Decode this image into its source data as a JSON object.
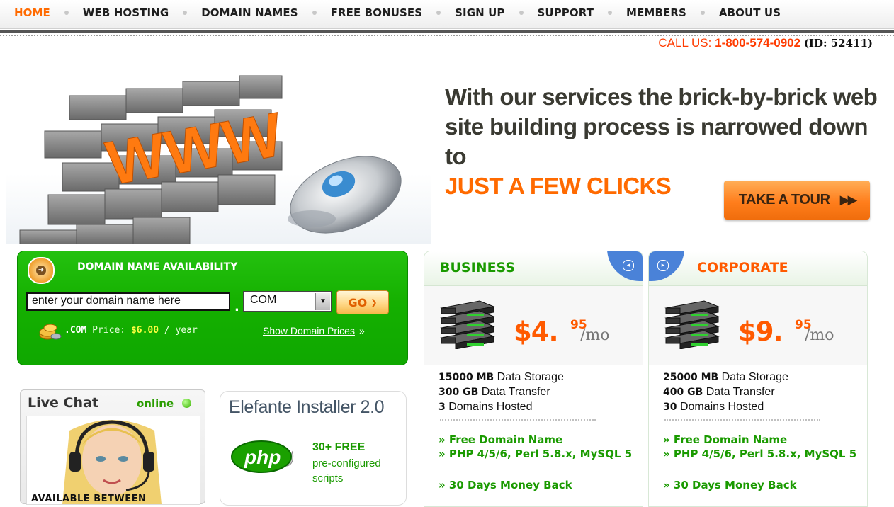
{
  "nav": {
    "items": [
      "HOME",
      "WEB HOSTING",
      "DOMAIN NAMES",
      "FREE BONUSES",
      "SIGN UP",
      "SUPPORT",
      "MEMBERS",
      "ABOUT US"
    ]
  },
  "phone": {
    "label": "CALL US:",
    "number": "1-800-574-0902",
    "id": "(ID: 52411)"
  },
  "hero": {
    "image_text": "WWW",
    "line1": "With our services the brick-by-brick web",
    "line2": "site building process is narrowed down to",
    "line3": "JUST A FEW CLICKS",
    "tour_label": "TAKE A TOUR",
    "tour_arrows": "▶▶"
  },
  "domain": {
    "title": "DOMAIN NAME AVAILABILITY",
    "input_value": "enter your domain name here",
    "dot": ".",
    "tld_selected": "COM",
    "go_label": "GO",
    "price_tld": ".COM",
    "price_label": "Price:",
    "price_value": "$6.00",
    "price_unit": "/ year",
    "show_prices": "Show Domain Prices",
    "show_prices_arrow": "»"
  },
  "chat": {
    "title": "Live Chat",
    "status": "online",
    "available": "AVAILABLE BETWEEN"
  },
  "installer": {
    "title": "Elefante Installer 2.0",
    "logo": "php",
    "count": "30+ FREE",
    "desc": "pre-configured scripts"
  },
  "plans": [
    {
      "name": "BUSINESS",
      "price": "$4.",
      "cents": "95",
      "unit": "/mo",
      "specs": [
        {
          "value": "15000 MB",
          "label": "Data Storage"
        },
        {
          "value": "300 GB",
          "label": "Data Transfer"
        },
        {
          "value": "3",
          "label": "Domains Hosted"
        }
      ],
      "features": [
        "» Free Domain Name",
        "» PHP 4/5/6, Perl 5.8.x, MySQL 5",
        "» 30 Days Money Back"
      ]
    },
    {
      "name": "CORPORATE",
      "price": "$9.",
      "cents": "95",
      "unit": "/mo",
      "specs": [
        {
          "value": "25000 MB",
          "label": "Data Storage"
        },
        {
          "value": "400 GB",
          "label": "Data Transfer"
        },
        {
          "value": "30",
          "label": "Domains Hosted"
        }
      ],
      "features": [
        "» Free Domain Name",
        "» PHP 4/5/6, Perl 5.8.x, MySQL 5",
        "» 30 Days Money Back"
      ]
    }
  ],
  "colors": {
    "accent": "#ff6a00",
    "green": "#1a9a00",
    "domain_box": "#15b000",
    "corner_blue": "#4a82d8"
  },
  "icons": [
    "circle-arrow-icon",
    "coins-icon",
    "online-dot-icon",
    "server-icon",
    "php-logo",
    "mouse-icon"
  ]
}
